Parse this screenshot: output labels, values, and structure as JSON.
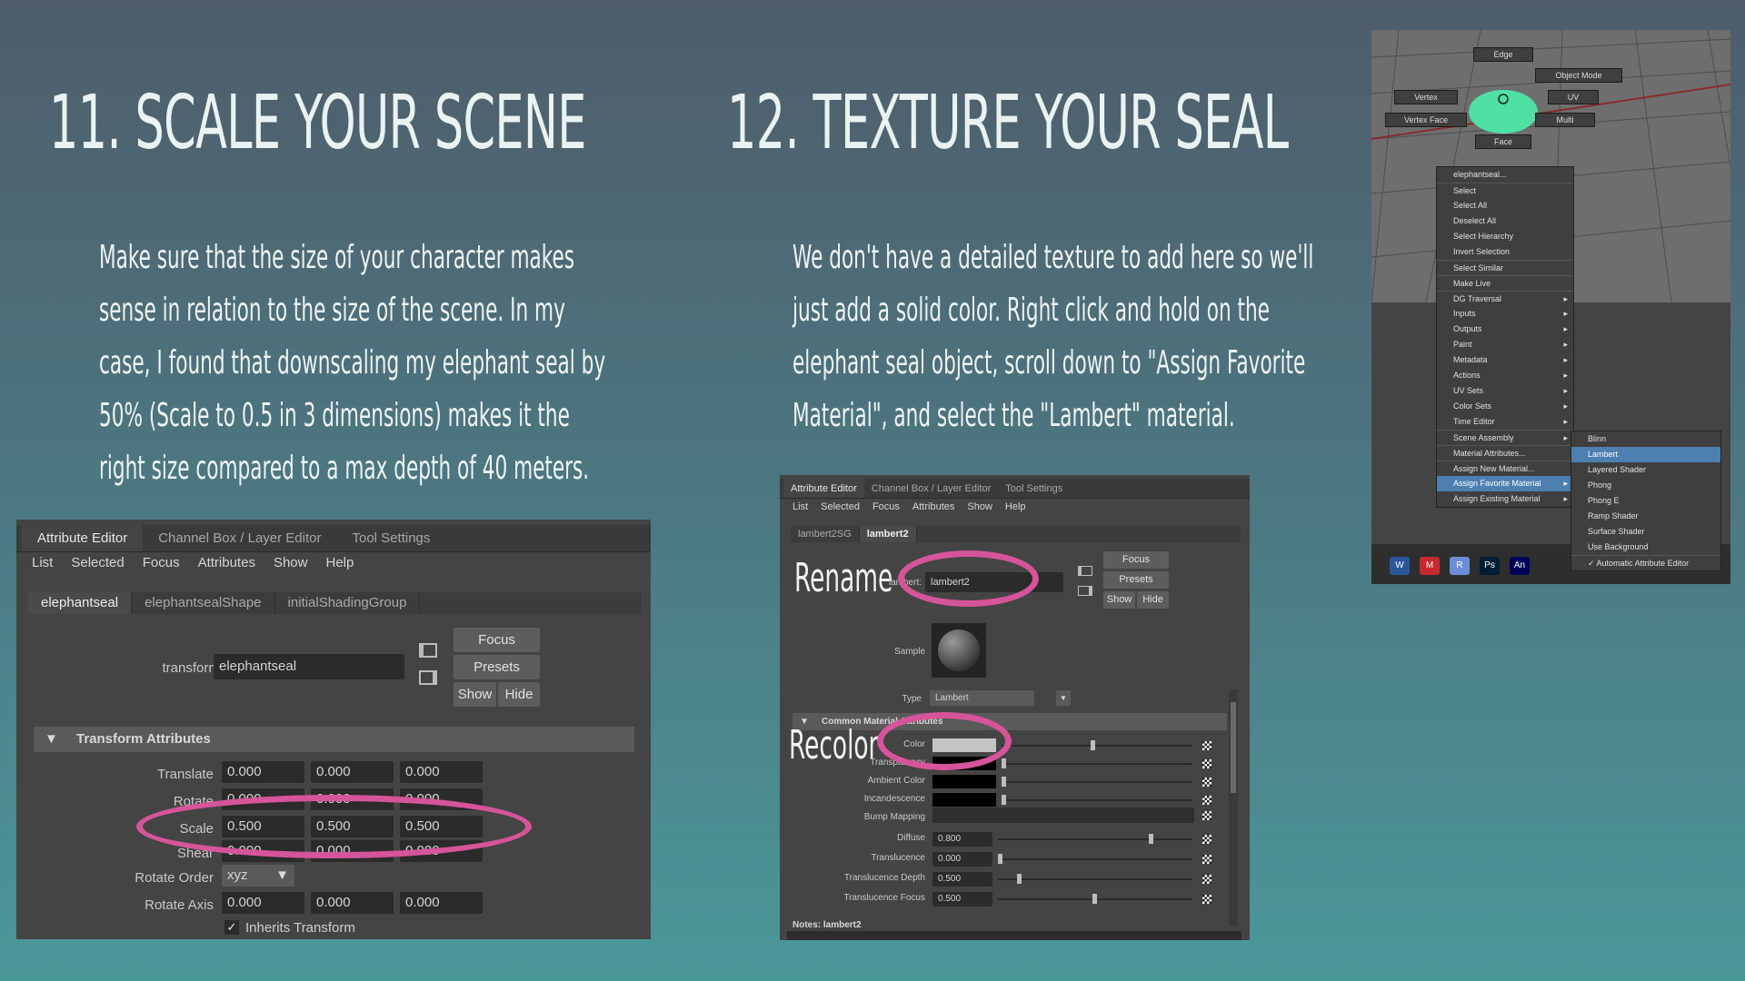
{
  "left": {
    "heading": "11. SCALE YOUR SCENE",
    "paragraph_lines": [
      "Make sure that the size of your character makes",
      "sense in relation to the size of the scene. In my",
      "case, I found that downscaling my elephant seal by",
      "50% (Scale to 0.5 in 3 dimensions) makes it the",
      "right size compared to a max depth of 40 meters."
    ]
  },
  "right": {
    "heading": "12. TEXTURE YOUR SEAL",
    "paragraph_lines": [
      "We don't have a detailed texture to add here so we'll",
      "just add a solid color. Right click and hold on the",
      "elephant seal object, scroll down to \"Assign Favorite",
      "Material\", and select the \"Lambert\" material."
    ]
  },
  "attr_editor1": {
    "tabs": [
      "Attribute Editor",
      "Channel Box / Layer Editor",
      "Tool Settings"
    ],
    "menu": [
      "List",
      "Selected",
      "Focus",
      "Attributes",
      "Show",
      "Help"
    ],
    "node_tabs": [
      "elephantseal",
      "elephantsealShape",
      "initialShadingGroup"
    ],
    "transform_label": "transform:",
    "transform_value": "elephantseal",
    "buttons": {
      "focus": "Focus",
      "presets": "Presets",
      "show": "Show",
      "hide": "Hide"
    },
    "section": "Transform Attributes",
    "rows": [
      {
        "label": "Translate",
        "values": [
          "0.000",
          "0.000",
          "0.000"
        ]
      },
      {
        "label": "Rotate",
        "values": [
          "0.000",
          "0.000",
          "0.000"
        ]
      },
      {
        "label": "Scale",
        "values": [
          "0.500",
          "0.500",
          "0.500"
        ]
      },
      {
        "label": "Shear",
        "values": [
          "0.000",
          "0.000",
          "0.000"
        ]
      }
    ],
    "rotate_order_label": "Rotate Order",
    "rotate_order_value": "xyz",
    "rotate_axis_label": "Rotate Axis",
    "rotate_axis_values": [
      "0.000",
      "0.000",
      "0.000"
    ],
    "inherits": "Inherits Transform"
  },
  "attr_editor2": {
    "tabs": [
      "Attribute Editor",
      "Channel Box / Layer Editor",
      "Tool Settings"
    ],
    "menu": [
      "List",
      "Selected",
      "Focus",
      "Attributes",
      "Show",
      "Help"
    ],
    "node_tabs": [
      "lambert2SG",
      "lambert2"
    ],
    "rename_annotation": "Rename",
    "name_label": "lambert:",
    "name_value": "lambert2",
    "buttons": {
      "focus": "Focus",
      "presets": "Presets",
      "show": "Show",
      "hide": "Hide"
    },
    "sample_label": "Sample",
    "type_label": "Type",
    "type_value": "Lambert",
    "section": "Common Material Attributes",
    "recolor_annotation": "Recolor",
    "color_rows": [
      {
        "label": "Color",
        "swatch": "#c4c4c4",
        "slider": 0.48
      },
      {
        "label": "Transparency",
        "swatch": "#000000",
        "slider": 0.0
      },
      {
        "label": "Ambient Color",
        "swatch": "#000000",
        "slider": 0.0
      },
      {
        "label": "Incandescence",
        "swatch": "#000000",
        "slider": 0.0
      }
    ],
    "bump_label": "Bump Mapping",
    "value_rows": [
      {
        "label": "Diffuse",
        "value": "0.800",
        "slider": 0.8
      },
      {
        "label": "Translucence",
        "value": "0.000",
        "slider": 0.0
      },
      {
        "label": "Translucence Depth",
        "value": "0.500",
        "slider": 0.1
      },
      {
        "label": "Translucence Focus",
        "value": "0.500",
        "slider": 0.5
      }
    ],
    "notes": "Notes: lambert2"
  },
  "maya_menu": {
    "marking_menu": [
      "Edge",
      "Object Mode",
      "Vertex",
      "UV",
      "Vertex Face",
      "Multi",
      "Face"
    ],
    "context_items": [
      {
        "label": "elephantseal...",
        "arrow": false
      },
      {
        "label": "Select",
        "arrow": false
      },
      {
        "label": "Select All",
        "arrow": false
      },
      {
        "label": "Deselect All",
        "arrow": false
      },
      {
        "label": "Select Hierarchy",
        "arrow": false
      },
      {
        "label": "Invert Selection",
        "arrow": false
      },
      {
        "label": "Select Similar",
        "arrow": false
      },
      {
        "label": "Make Live",
        "arrow": false
      },
      {
        "label": "DG Traversal",
        "arrow": true
      },
      {
        "label": "Inputs",
        "arrow": true
      },
      {
        "label": "Outputs",
        "arrow": true
      },
      {
        "label": "Paint",
        "arrow": true
      },
      {
        "label": "Metadata",
        "arrow": true
      },
      {
        "label": "Actions",
        "arrow": true
      },
      {
        "label": "UV Sets",
        "arrow": true
      },
      {
        "label": "Color Sets",
        "arrow": true
      },
      {
        "label": "Time Editor",
        "arrow": true
      },
      {
        "label": "Scene Assembly",
        "arrow": true
      },
      {
        "label": "Material Attributes...",
        "arrow": false
      },
      {
        "label": "Assign New Material...",
        "arrow": false
      },
      {
        "label": "Assign Favorite Material",
        "arrow": true
      },
      {
        "label": "Assign Existing Material",
        "arrow": true
      }
    ],
    "submenu": [
      "Blinn",
      "Lambert",
      "Layered Shader",
      "Phong",
      "Phong E",
      "Ramp Shader",
      "Surface Shader",
      "Use Background"
    ],
    "auto_attr": "Automatic Attribute Editor",
    "taskbar": [
      "W",
      "M",
      "R",
      "Ps",
      "An"
    ]
  },
  "colors": {
    "highlight_ring": "#d6549a",
    "menu_highlight": "#4d7fb0",
    "seal_green": "#4fe0a6"
  }
}
